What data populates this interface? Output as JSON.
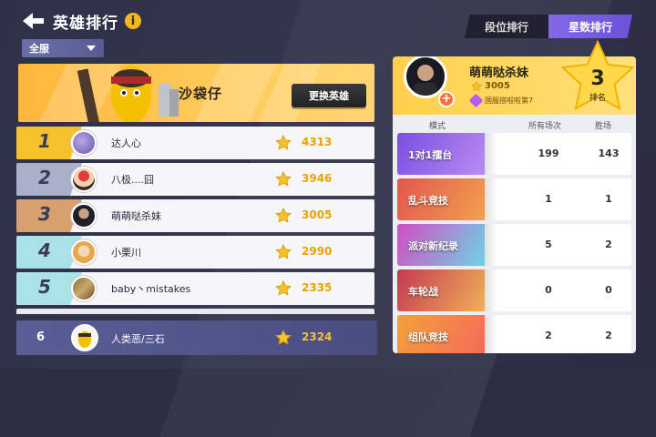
{
  "header": {
    "title": "英雄排行",
    "info_glyph": "i"
  },
  "filter": {
    "selected": "全服"
  },
  "hero": {
    "name": "沙袋仔",
    "change_button": "更换英雄"
  },
  "rows": [
    {
      "rank": "1",
      "name": "达人心",
      "score": "4313",
      "band": "#f5c22e"
    },
    {
      "rank": "2",
      "name": "八极....囧",
      "score": "3946",
      "band": "#a9b0c8"
    },
    {
      "rank": "3",
      "name": "萌萌哒杀妹",
      "score": "3005",
      "band": "#d8a06c"
    },
    {
      "rank": "4",
      "name": "小栗川",
      "score": "2990",
      "band": "#a9e3e7"
    },
    {
      "rank": "5",
      "name": "baby丶mistakes",
      "score": "2335",
      "band": "#a9e3e7"
    }
  ],
  "mine": {
    "rank": "6",
    "name": "人类恶/三石",
    "score": "2324"
  },
  "tabs": [
    {
      "label": "段位排行"
    },
    {
      "label": "星数排行"
    }
  ],
  "profile": {
    "name": "萌萌哒杀妹",
    "stars": "3005",
    "badge": "国服搭啦啦第7",
    "rank_num": "3",
    "rank_label": "排名"
  },
  "stats": {
    "headers": {
      "mode": "模式",
      "total": "所有场次",
      "wins": "胜场"
    },
    "rows": [
      {
        "mode": "1对1擂台",
        "total": "199",
        "wins": "143",
        "bg": "#7a4fe0"
      },
      {
        "mode": "乱斗竞技",
        "total": "1",
        "wins": "1",
        "bg": "#e3564e"
      },
      {
        "mode": "派对新纪录",
        "total": "5",
        "wins": "2",
        "bg": "#d14ec2"
      },
      {
        "mode": "车轮战",
        "total": "0",
        "wins": "0",
        "bg": "#c23a4f"
      },
      {
        "mode": "组队竞技",
        "total": "2",
        "wins": "2",
        "bg": "#f2a23a"
      }
    ]
  },
  "colors": {
    "accent": "#f5c22e",
    "tab_active": "#7a5fe6",
    "panel": "#5a5e96"
  }
}
